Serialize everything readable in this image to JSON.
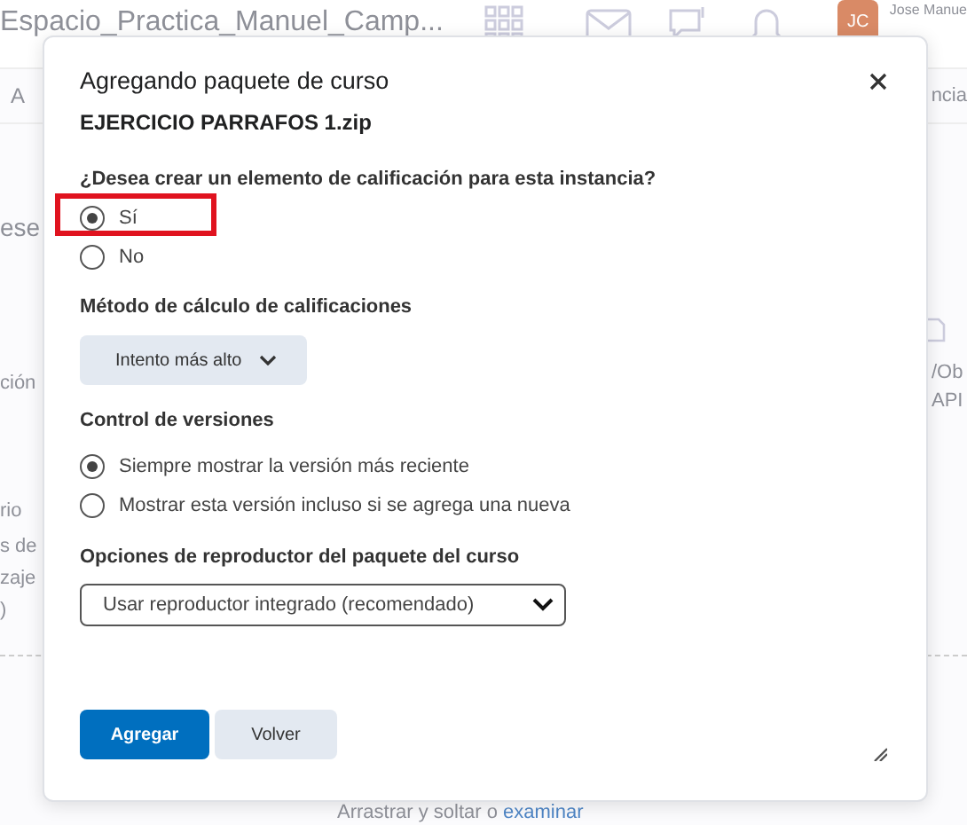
{
  "background": {
    "header_title": "Espacio_Practica_Manuel_Camp...",
    "avatar_initials": "JC",
    "user_name": "Jose Manue",
    "nav_left": "A",
    "nav_right": "ncia",
    "left_fragments": [
      "ese",
      "ción",
      "rio",
      "s de",
      "zaje",
      ")"
    ],
    "right_fragments": [
      "/Ob",
      "API"
    ],
    "drop_text": "Arrastrar y soltar o",
    "drop_link": "examinar"
  },
  "dialog": {
    "title": "Agregando paquete de curso",
    "filename": "EJERCICIO PARRAFOS 1.zip",
    "grade_question": "¿Desea crear un elemento de calificación para esta instancia?",
    "grade_options": [
      {
        "label": "Sí",
        "selected": true,
        "highlighted": true
      },
      {
        "label": "No",
        "selected": false,
        "highlighted": false
      }
    ],
    "method_label": "Método de cálculo de calificaciones",
    "method_value": "Intento más alto",
    "version_label": "Control de versiones",
    "version_options": [
      {
        "label": "Siempre mostrar la versión más reciente",
        "selected": true
      },
      {
        "label": "Mostrar esta versión incluso si se agrega una nueva",
        "selected": false
      }
    ],
    "player_label": "Opciones de reproductor del paquete del curso",
    "player_value": "Usar reproductor integrado (recomendado)",
    "buttons": [
      {
        "label": "Agregar",
        "kind": "primary"
      },
      {
        "label": "Volver",
        "kind": "secondary"
      }
    ]
  }
}
